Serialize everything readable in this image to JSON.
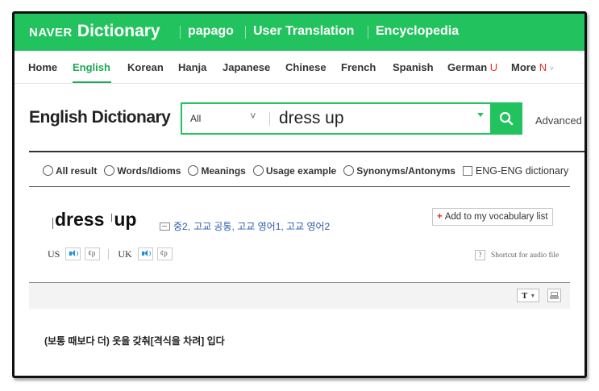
{
  "header": {
    "brand": "NAVER",
    "product": "Dictionary",
    "services": [
      "papago",
      "User Translation",
      "Encyclopedia"
    ],
    "bg_color": "#22c35e"
  },
  "nav": {
    "items": [
      "Home",
      "English",
      "Korean",
      "Hanja",
      "Japanese",
      "Chinese",
      "French",
      "Spanish",
      "German",
      "More"
    ],
    "active": "English",
    "german_badge": "U",
    "more_badge": "N",
    "more_caret": "˅"
  },
  "search": {
    "page_title": "English Dictionary",
    "scope_value": "All",
    "scope_caret": "˅",
    "query": "dress up",
    "advanced_label": "Advanced"
  },
  "filters": {
    "options": [
      "All result",
      "Words/Idioms",
      "Meanings",
      "Usage example",
      "Synonyms/Antonyms"
    ],
    "checkbox_label": "ENG-ENG dictionary"
  },
  "entry": {
    "headword_parts": [
      "dress",
      "up"
    ],
    "level_prefix": "중2,",
    "levels": "고교 공통, 고교 영어1, 고교 영어2",
    "vocab_button": "Add to my vocabulary list",
    "vocab_plus": "+",
    "pron_us": "US",
    "pron_uk": "UK",
    "speed_icon": "¢p",
    "shortcut_q": "?",
    "shortcut_label": "Shortcut for audio file",
    "meaning": "(보통 때보다 더) 옷을 갖춰[격식을 차려] 입다"
  },
  "toolbar": {
    "text_size": "T",
    "text_size_caret": "▼"
  }
}
